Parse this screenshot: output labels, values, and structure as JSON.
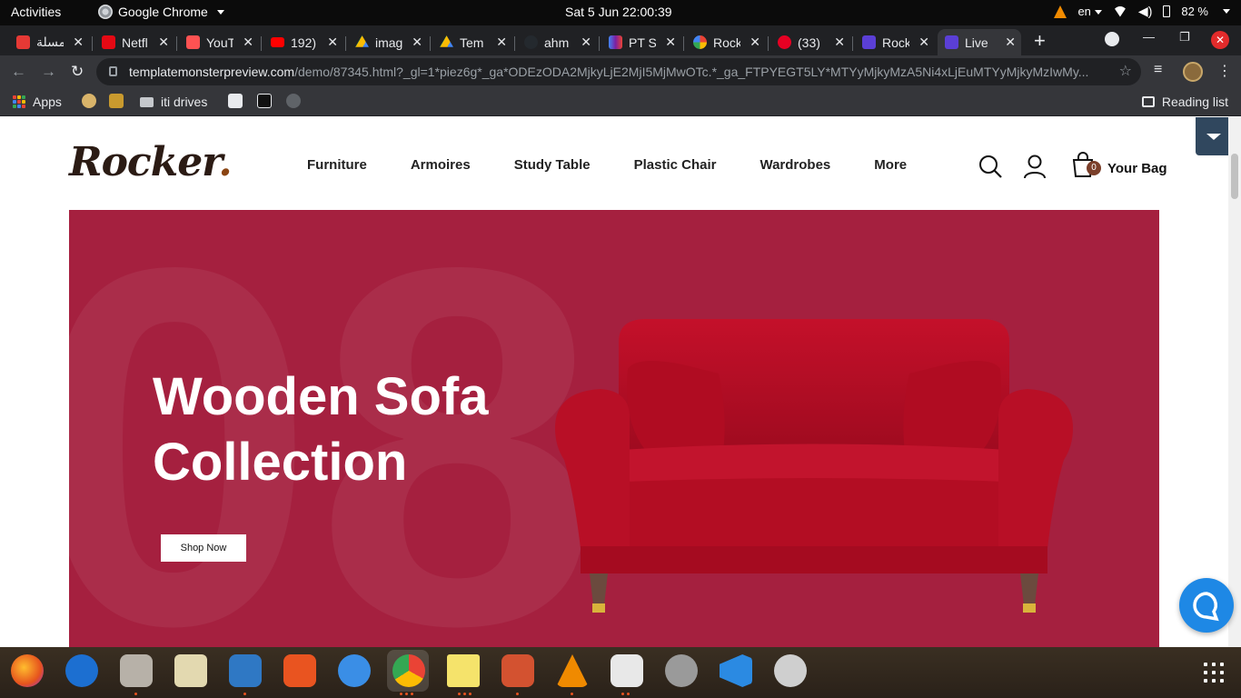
{
  "system": {
    "activities": "Activities",
    "app_name": "Google Chrome",
    "clock": "Sat 5 Jun  22:00:39",
    "lang": "en",
    "battery": "82 %"
  },
  "tabs": [
    {
      "title": "مسلة",
      "color": "#e53935"
    },
    {
      "title": "Netfl",
      "color": "#e50914"
    },
    {
      "title": "YouT",
      "color": "#ff5252"
    },
    {
      "title": "192)",
      "color": "#ff0000"
    },
    {
      "title": "imag",
      "color": "#34a853"
    },
    {
      "title": "Tem",
      "color": "#fbbc04"
    },
    {
      "title": "ahm",
      "color": "#24292e"
    },
    {
      "title": "PT S",
      "color": "#7b1fa2"
    },
    {
      "title": "Rock",
      "color": "#4285f4"
    },
    {
      "title": "(33)",
      "color": "#e60023"
    },
    {
      "title": "Rock",
      "color": "#5b3fd6"
    },
    {
      "title": "Live",
      "color": "#5b3fd6"
    }
  ],
  "address": {
    "host": "templatemonsterpreview.com",
    "path": "/demo/87345.html?_gl=1*piez6g*_ga*ODEzODA2MjkyLjE2MjI5MjMwOTc.*_ga_FTPYEGT5LY*MTYyMjkyMzA5Ni4xLjEuMTYyMjkyMzIwMy..."
  },
  "bookmarks": {
    "apps": "Apps",
    "iti": "iti drives",
    "reading_list": "Reading list"
  },
  "site": {
    "logo": "Rocker",
    "logo_dot": ".",
    "nav": [
      "Furniture",
      "Armoires",
      "Study Table",
      "Plastic Chair",
      "Wardrobes",
      "More"
    ],
    "bag_count": "0",
    "bag_label": "Your Bag",
    "hero_line1": "Wooden Sofa",
    "hero_line2": "Collection",
    "shop_now": "Shop Now",
    "hero_bg_number": "08"
  },
  "colors": {
    "hero_bg": "#a5203f",
    "chrome_dark": "#202124",
    "chrome_mid": "#35363a",
    "accent": "#7b3f2a"
  }
}
